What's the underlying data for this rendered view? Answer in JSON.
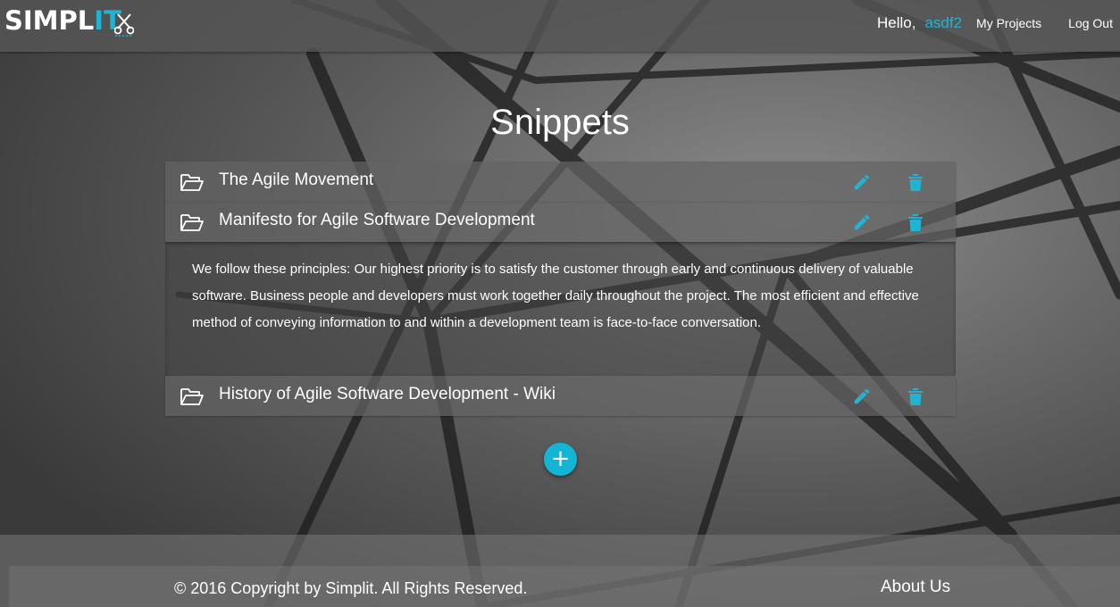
{
  "navbar": {
    "logo_main": "SIMPL",
    "logo_accent": "IT",
    "greeting": "Hello,",
    "username": "asdf2",
    "my_projects": "My Projects",
    "log_out": "Log Out"
  },
  "main": {
    "title": "Snippets",
    "snippets": [
      {
        "title": "The Agile Movement",
        "expanded": false
      },
      {
        "title": "Manifesto for Agile Software Development",
        "expanded": true,
        "body": "We follow these principles: Our highest priority is to satisfy the customer through early and continuous delivery of valuable software. Business people and developers must work together daily throughout the project. The most efficient and effective method of conveying information to and within a development team is face-to-face conversation."
      },
      {
        "title": "History of Agile Software Development - Wiki",
        "expanded": false
      }
    ],
    "add_label": "+"
  },
  "footer": {
    "copyright": "© 2016 Copyright by Simplit. All Rights Reserved.",
    "about": "About Us"
  },
  "icons": {
    "folder": "folder-open-icon",
    "edit": "pencil-icon",
    "delete": "trash-icon",
    "logo": "scissors-icon"
  },
  "colors": {
    "accent": "#1fb4d4",
    "navbar": "#555555",
    "text": "#ffffff"
  }
}
